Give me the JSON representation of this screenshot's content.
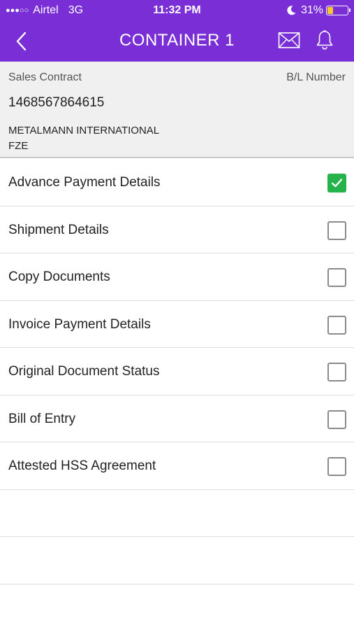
{
  "status_bar": {
    "signal": "●●●○○",
    "carrier": "Airtel",
    "network": "3G",
    "time": "11:32 PM",
    "battery_percent_text": "31%",
    "battery_level": 0.31,
    "icons": [
      "moon-icon",
      "battery-icon"
    ]
  },
  "header": {
    "title": "CONTAINER 1",
    "icons": [
      "back-chevron-icon",
      "mail-icon",
      "bell-icon"
    ],
    "color": "#7a2fd6"
  },
  "info": {
    "sales_contract_label": "Sales Contract",
    "bl_number_label": "B/L Number",
    "sales_contract_number": "1468567864615",
    "company_line1": "METALMANN INTERNATIONAL",
    "company_line2": "FZE"
  },
  "checklist": [
    {
      "label": "Advance Payment Details",
      "checked": true
    },
    {
      "label": "Shipment Details",
      "checked": false
    },
    {
      "label": "Copy Documents",
      "checked": false
    },
    {
      "label": "Invoice Payment Details",
      "checked": false
    },
    {
      "label": "Original Document Status",
      "checked": false
    },
    {
      "label": "Bill of Entry",
      "checked": false
    },
    {
      "label": "Attested HSS Agreement",
      "checked": false
    }
  ],
  "colors": {
    "checked": "#27b34b",
    "accent": "#7a2fd6"
  }
}
